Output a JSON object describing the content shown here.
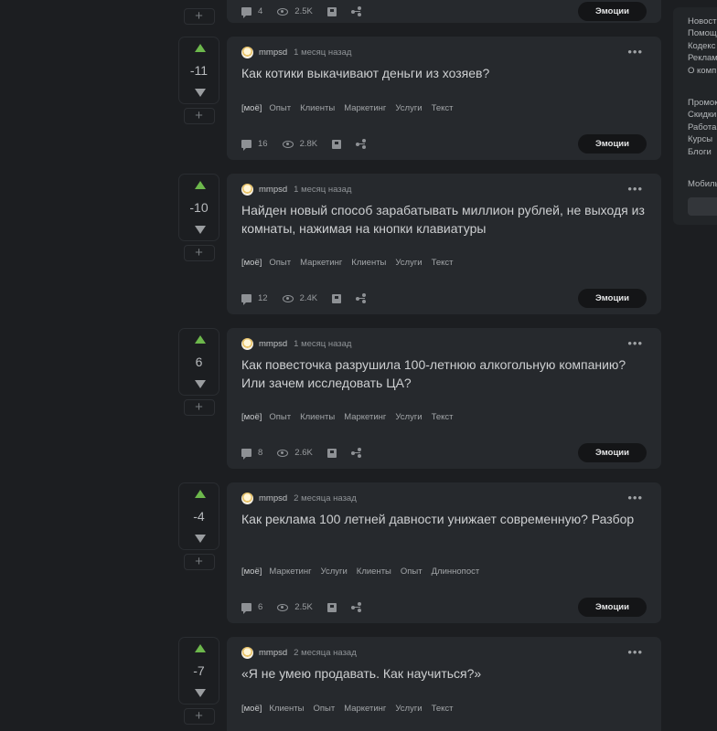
{
  "header_strip": {
    "comments": "4",
    "views": "2.5K",
    "emotions_label": "Эмоции"
  },
  "posts": [
    {
      "rating": "-11",
      "author": "mmpsd",
      "time": "1 месяц назад",
      "title": "Как котики выкачивают деньги из хозяев?",
      "tags": [
        "[моё]",
        "Опыт",
        "Клиенты",
        "Маркетинг",
        "Услуги",
        "Текст"
      ],
      "comments": "16",
      "views": "2.8K",
      "emotions_label": "Эмоции"
    },
    {
      "rating": "-10",
      "author": "mmpsd",
      "time": "1 месяц назад",
      "title": "Найден новый способ зарабатывать миллион рублей, не выходя из комнаты, нажимая на кнопки клавиатуры",
      "tags": [
        "[моё]",
        "Опыт",
        "Маркетинг",
        "Клиенты",
        "Услуги",
        "Текст"
      ],
      "comments": "12",
      "views": "2.4K",
      "emotions_label": "Эмоции"
    },
    {
      "rating": "6",
      "author": "mmpsd",
      "time": "1 месяц назад",
      "title": "Как повесточка разрушила 100-летнюю алкогольную компанию? Или зачем исследовать ЦА?",
      "tags": [
        "[моё]",
        "Опыт",
        "Клиенты",
        "Маркетинг",
        "Услуги",
        "Текст"
      ],
      "comments": "8",
      "views": "2.6K",
      "emotions_label": "Эмоции"
    },
    {
      "rating": "-4",
      "author": "mmpsd",
      "time": "2 месяца назад",
      "title": "Как реклама 100 летней давности унижает современную? Разбор",
      "tags": [
        "[моё]",
        "Маркетинг",
        "Услуги",
        "Клиенты",
        "Опыт",
        "Длиннопост"
      ],
      "comments": "6",
      "views": "2.5K",
      "emotions_label": "Эмоции"
    },
    {
      "rating": "-7",
      "author": "mmpsd",
      "time": "2 месяца назад",
      "title": "«Я не умею продавать. Как научиться?»",
      "tags": [
        "[моё]",
        "Клиенты",
        "Опыт",
        "Маркетинг",
        "Услуги",
        "Текст"
      ]
    }
  ],
  "sidebar": {
    "links_top": [
      "Новост",
      "Помощ",
      "Кодекс",
      "Реклам",
      "О комп"
    ],
    "links_bottom": [
      "Промок",
      "Скидки",
      "Работа",
      "Курсы",
      "Блоги"
    ],
    "mobile_label": "Мобиль"
  },
  "colors": {
    "background": "#1c1e21",
    "card": "#26292d",
    "upvote": "#6db84c",
    "emotions_button": "#141517"
  },
  "icons": [
    "comment-icon",
    "eye-icon",
    "save-icon",
    "share-icon",
    "more-icon",
    "upvote-icon",
    "downvote-icon",
    "plus-icon"
  ]
}
